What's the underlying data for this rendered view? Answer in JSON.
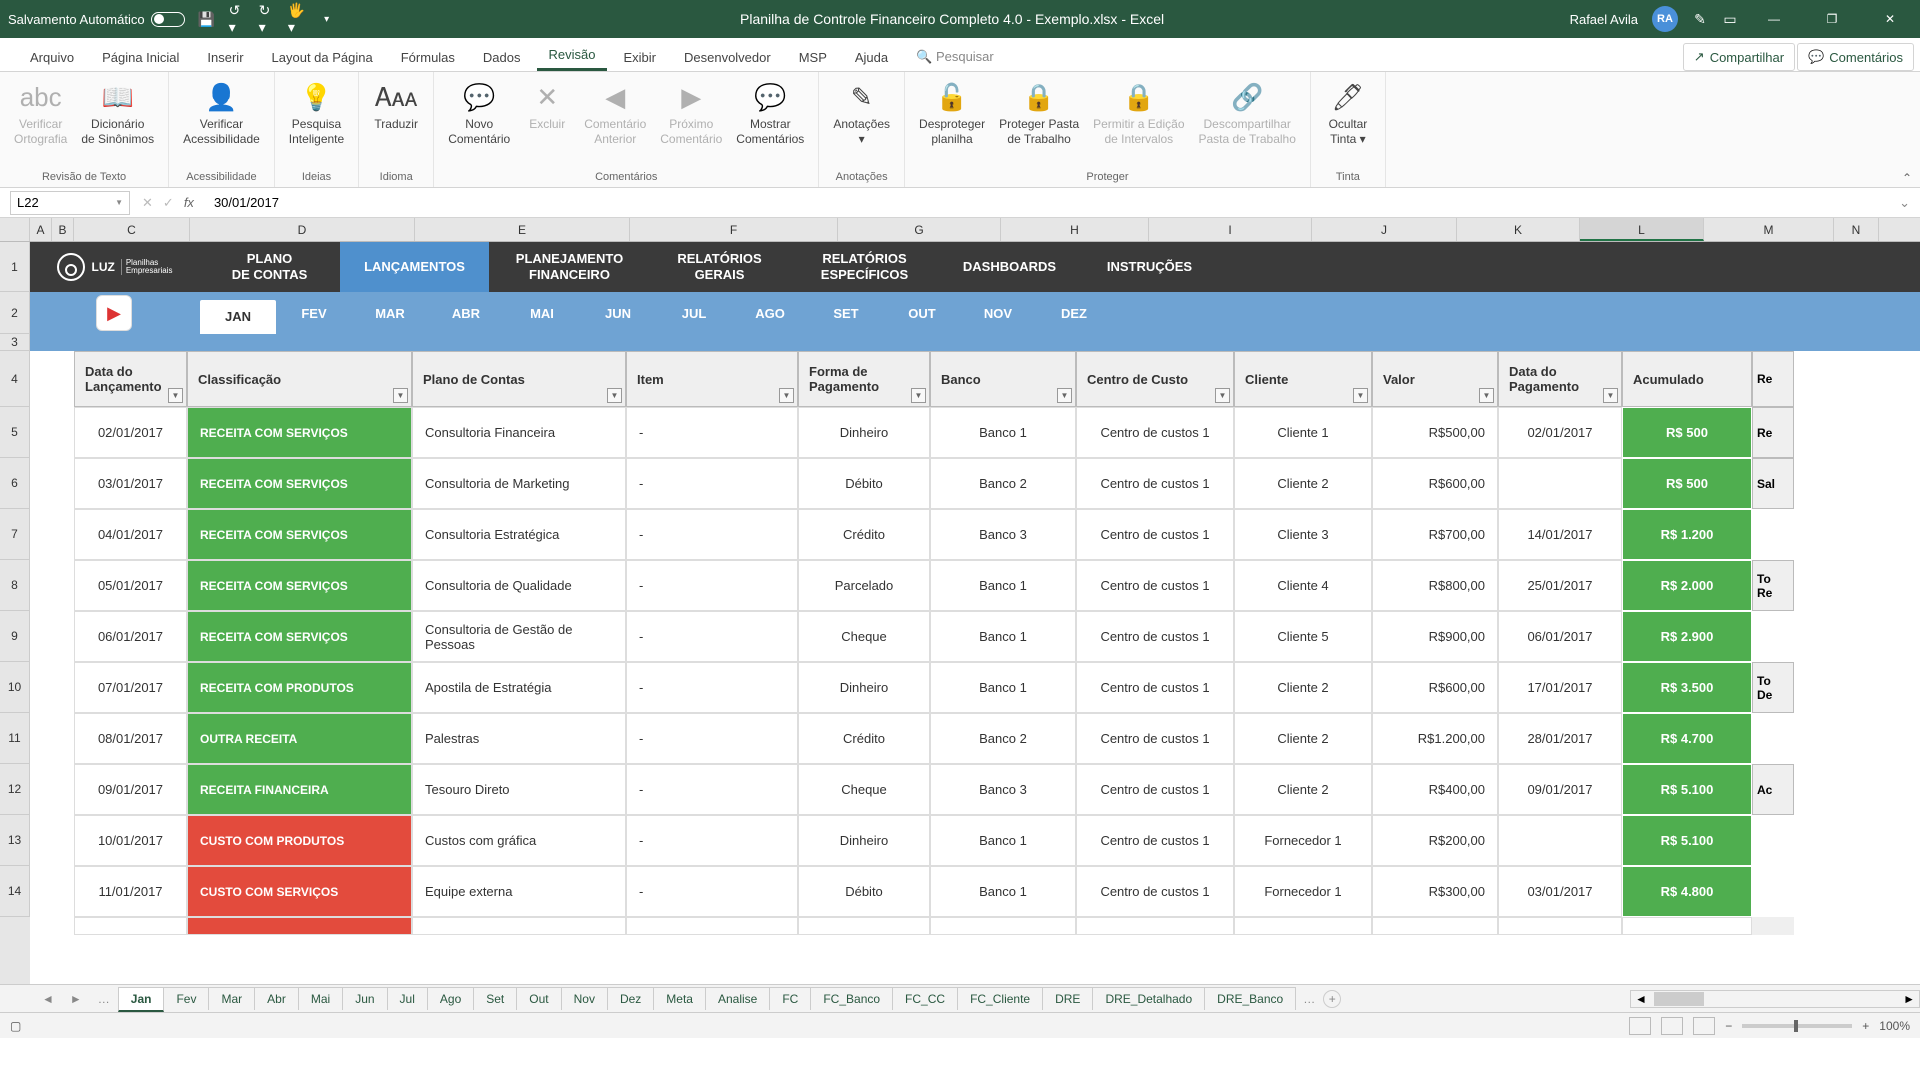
{
  "title": "Planilha de Controle Financeiro Completo 4.0 - Exemplo.xlsx  -  Excel",
  "autosave_label": "Salvamento Automático",
  "user_name": "Rafael Avila",
  "user_initials": "RA",
  "ribbon_tabs": [
    "Arquivo",
    "Página Inicial",
    "Inserir",
    "Layout da Página",
    "Fórmulas",
    "Dados",
    "Revisão",
    "Exibir",
    "Desenvolvedor",
    "MSP",
    "Ajuda"
  ],
  "active_ribbon_tab": "Revisão",
  "search_placeholder": "Pesquisar",
  "share_label": "Compartilhar",
  "comments_label": "Comentários",
  "ribbon_groups": {
    "g1": {
      "buttons": [
        {
          "l": "Verificar\nOrtografia",
          "d": true
        },
        {
          "l": "Dicionário\nde Sinônimos"
        }
      ],
      "label": "Revisão de Texto"
    },
    "g2": {
      "buttons": [
        {
          "l": "Verificar\nAcessibilidade"
        }
      ],
      "label": "Acessibilidade"
    },
    "g3": {
      "buttons": [
        {
          "l": "Pesquisa\nInteligente"
        }
      ],
      "label": "Ideias"
    },
    "g4": {
      "buttons": [
        {
          "l": "Traduzir"
        }
      ],
      "label": "Idioma"
    },
    "g5": {
      "buttons": [
        {
          "l": "Novo\nComentário"
        },
        {
          "l": "Excluir",
          "d": true
        },
        {
          "l": "Comentário\nAnterior",
          "d": true
        },
        {
          "l": "Próximo\nComentário",
          "d": true
        },
        {
          "l": "Mostrar\nComentários"
        }
      ],
      "label": "Comentários"
    },
    "g6": {
      "buttons": [
        {
          "l": "Anotações\n▾"
        }
      ],
      "label": "Anotações"
    },
    "g7": {
      "buttons": [
        {
          "l": "Desproteger\nplanilha"
        },
        {
          "l": "Proteger Pasta\nde Trabalho"
        },
        {
          "l": "Permitir a Edição\nde Intervalos",
          "d": true
        },
        {
          "l": "Descompartilhar\nPasta de Trabalho",
          "d": true
        }
      ],
      "label": "Proteger"
    },
    "g8": {
      "buttons": [
        {
          "l": "Ocultar\nTinta ▾"
        }
      ],
      "label": "Tinta"
    }
  },
  "namebox": "L22",
  "formula": "30/01/2017",
  "columns": [
    "A",
    "B",
    "C",
    "D",
    "E",
    "F",
    "G",
    "H",
    "I",
    "J",
    "K",
    "L",
    "M",
    "N"
  ],
  "selected_col": "L",
  "rows": [
    1,
    2,
    3,
    4,
    5,
    6,
    7,
    8,
    9,
    10,
    11,
    12,
    13,
    14
  ],
  "nav": {
    "brand_top": "LUZ",
    "brand_sub": "Planilhas\nEmpresariais",
    "items": [
      "PLANO DE CONTAS",
      "LANÇAMENTOS",
      "PLANEJAMENTO FINANCEIRO",
      "RELATÓRIOS GERAIS",
      "RELATÓRIOS ESPECÍFICOS",
      "DASHBOARDS",
      "INSTRUÇÕES"
    ],
    "active": "LANÇAMENTOS"
  },
  "months": [
    "JAN",
    "FEV",
    "MAR",
    "ABR",
    "MAI",
    "JUN",
    "JUL",
    "AGO",
    "SET",
    "OUT",
    "NOV",
    "DEZ"
  ],
  "active_month": "JAN",
  "headers": [
    "Data do Lançamento",
    "Classificação",
    "Plano de Contas",
    "Item",
    "Forma de Pagamento",
    "Banco",
    "Centro de Custo",
    "Cliente",
    "Valor",
    "Data do Pagamento",
    "Acumulado",
    "Re"
  ],
  "side_labels": [
    "Re",
    "Sal",
    "To\nRe",
    "To\nDe",
    "Ac"
  ],
  "data_rows": [
    {
      "data": "02/01/2017",
      "class": "RECEITA COM SERVIÇOS",
      "plano": "Consultoria Financeira",
      "item": "-",
      "forma": "Dinheiro",
      "banco": "Banco 1",
      "centro": "Centro de custos 1",
      "cliente": "Cliente 1",
      "valor": "R$500,00",
      "datapg": "02/01/2017",
      "acc": "R$ 500",
      "ct": "green"
    },
    {
      "data": "03/01/2017",
      "class": "RECEITA COM SERVIÇOS",
      "plano": "Consultoria de Marketing",
      "item": "-",
      "forma": "Débito",
      "banco": "Banco 2",
      "centro": "Centro de custos 1",
      "cliente": "Cliente 2",
      "valor": "R$600,00",
      "datapg": "",
      "acc": "R$ 500",
      "ct": "green"
    },
    {
      "data": "04/01/2017",
      "class": "RECEITA COM SERVIÇOS",
      "plano": "Consultoria Estratégica",
      "item": "-",
      "forma": "Crédito",
      "banco": "Banco 3",
      "centro": "Centro de custos 1",
      "cliente": "Cliente 3",
      "valor": "R$700,00",
      "datapg": "14/01/2017",
      "acc": "R$ 1.200",
      "ct": "green"
    },
    {
      "data": "05/01/2017",
      "class": "RECEITA COM SERVIÇOS",
      "plano": "Consultoria de Qualidade",
      "item": "-",
      "forma": "Parcelado",
      "banco": "Banco 1",
      "centro": "Centro de custos 1",
      "cliente": "Cliente 4",
      "valor": "R$800,00",
      "datapg": "25/01/2017",
      "acc": "R$ 2.000",
      "ct": "green"
    },
    {
      "data": "06/01/2017",
      "class": "RECEITA COM SERVIÇOS",
      "plano": "Consultoria de Gestão de Pessoas",
      "item": "-",
      "forma": "Cheque",
      "banco": "Banco 1",
      "centro": "Centro de custos 1",
      "cliente": "Cliente 5",
      "valor": "R$900,00",
      "datapg": "06/01/2017",
      "acc": "R$ 2.900",
      "ct": "green"
    },
    {
      "data": "07/01/2017",
      "class": "RECEITA COM PRODUTOS",
      "plano": "Apostila de Estratégia",
      "item": "-",
      "forma": "Dinheiro",
      "banco": "Banco 1",
      "centro": "Centro de custos 1",
      "cliente": "Cliente 2",
      "valor": "R$600,00",
      "datapg": "17/01/2017",
      "acc": "R$ 3.500",
      "ct": "green"
    },
    {
      "data": "08/01/2017",
      "class": "OUTRA RECEITA",
      "plano": "Palestras",
      "item": "-",
      "forma": "Crédito",
      "banco": "Banco 2",
      "centro": "Centro de custos 1",
      "cliente": "Cliente 2",
      "valor": "R$1.200,00",
      "datapg": "28/01/2017",
      "acc": "R$ 4.700",
      "ct": "green"
    },
    {
      "data": "09/01/2017",
      "class": "RECEITA FINANCEIRA",
      "plano": "Tesouro Direto",
      "item": "-",
      "forma": "Cheque",
      "banco": "Banco 3",
      "centro": "Centro de custos 1",
      "cliente": "Cliente 2",
      "valor": "R$400,00",
      "datapg": "09/01/2017",
      "acc": "R$ 5.100",
      "ct": "green"
    },
    {
      "data": "10/01/2017",
      "class": "CUSTO COM PRODUTOS",
      "plano": "Custos com gráfica",
      "item": "-",
      "forma": "Dinheiro",
      "banco": "Banco 1",
      "centro": "Centro de custos 1",
      "cliente": "Fornecedor 1",
      "valor": "R$200,00",
      "datapg": "",
      "acc": "R$ 5.100",
      "ct": "red"
    },
    {
      "data": "11/01/2017",
      "class": "CUSTO COM SERVIÇOS",
      "plano": "Equipe externa",
      "item": "-",
      "forma": "Débito",
      "banco": "Banco 1",
      "centro": "Centro de custos 1",
      "cliente": "Fornecedor 1",
      "valor": "R$300,00",
      "datapg": "03/01/2017",
      "acc": "R$ 4.800",
      "ct": "red"
    }
  ],
  "sheet_tabs": [
    "Jan",
    "Fev",
    "Mar",
    "Abr",
    "Mai",
    "Jun",
    "Jul",
    "Ago",
    "Set",
    "Out",
    "Nov",
    "Dez",
    "Meta",
    "Analise",
    "FC",
    "FC_Banco",
    "FC_CC",
    "FC_Cliente",
    "DRE",
    "DRE_Detalhado",
    "DRE_Banco"
  ],
  "active_sheet": "Jan",
  "zoom": "100%"
}
